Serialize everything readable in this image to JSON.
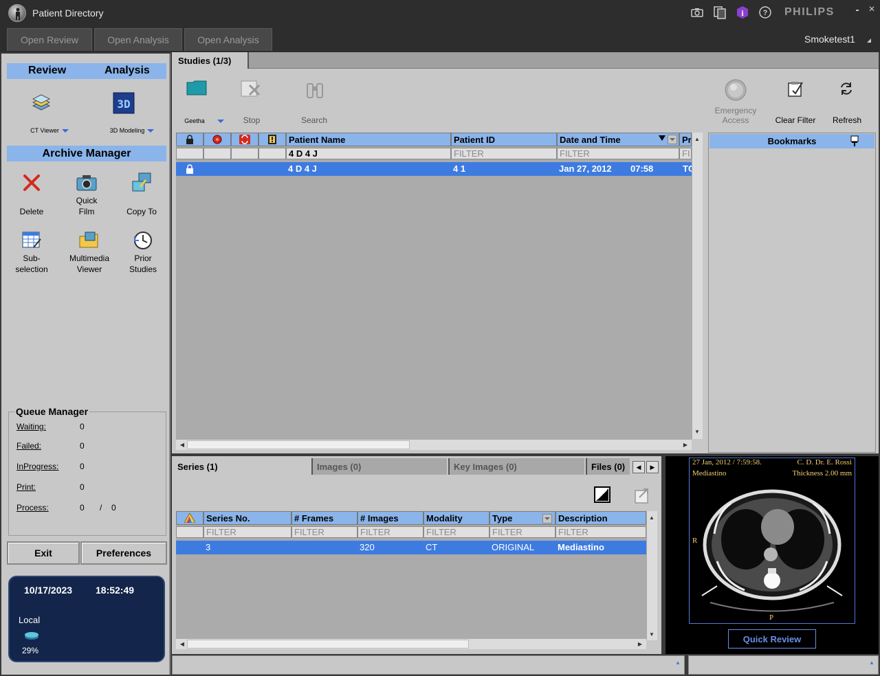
{
  "window": {
    "title": "Patient Directory",
    "brand": "PHILIPS",
    "minimize": "-",
    "close": "×"
  },
  "top_tabs": [
    "Open Review",
    "Open Analysis",
    "Open Analysis"
  ],
  "user": "Smoketest1",
  "left": {
    "review_label": "Review",
    "analysis_label": "Analysis",
    "ct_viewer": "CT Viewer",
    "modeling_3d": "3D Modeling",
    "archive_manager": "Archive Manager",
    "tools": [
      {
        "line1": "",
        "line2": "Delete",
        "icon": "delete-icon"
      },
      {
        "line1": "Quick",
        "line2": "Film",
        "icon": "camera-icon"
      },
      {
        "line1": "",
        "line2": "Copy To",
        "icon": "copy-to-icon"
      },
      {
        "line1": "Sub-",
        "line2": "selection",
        "icon": "subselection-icon"
      },
      {
        "line1": "Multimedia",
        "line2": "Viewer",
        "icon": "folder-icon"
      },
      {
        "line1": "Prior",
        "line2": "Studies",
        "icon": "clock-icon"
      }
    ],
    "queue": {
      "title": "Queue Manager",
      "rows": [
        {
          "label": "Waiting:",
          "value": "0"
        },
        {
          "label": "Failed:",
          "value": "0"
        },
        {
          "label": "InProgress:",
          "value": "0"
        },
        {
          "label": "Print:",
          "value": "0"
        },
        {
          "label": "Process:",
          "value": "0"
        }
      ],
      "process_sep": "/",
      "process_total": "0"
    },
    "exit_label": "Exit",
    "preferences_label": "Preferences",
    "status": {
      "date": "10/17/2023",
      "time": "18:52:49",
      "location": "Local",
      "disk_used": "29%"
    }
  },
  "studies": {
    "tab": "Studies (1/3)",
    "toolbar": {
      "source": "Geetha",
      "stop": "Stop",
      "search": "Search",
      "emergency1": "Emergency",
      "emergency2": "Access",
      "clear_filter": "Clear Filter",
      "refresh": "Refresh"
    },
    "columns": [
      "Patient Name",
      "Patient ID",
      "Date and Time",
      "Pr"
    ],
    "filter_text": "FILTER",
    "filter_name": "4 D 4 J",
    "filter_partial": "FI",
    "row": {
      "name": "4 D 4 J",
      "id": "4 1",
      "date": "Jan  27,  2012",
      "time": "07:58",
      "extra": "TC"
    },
    "bookmarks": "Bookmarks"
  },
  "series": {
    "tabs": [
      "Series (1)",
      "Images (0)",
      "Key Images (0)",
      "Files (0)"
    ],
    "columns": [
      "Series No.",
      "# Frames",
      "# Images",
      "Modality",
      "Type",
      "Description"
    ],
    "filter_text": "FILTER",
    "row": {
      "series_no": "3",
      "frames": "",
      "images": "320",
      "modality": "CT",
      "type": "ORIGINAL",
      "description": "Mediastino"
    }
  },
  "preview": {
    "date": "27 Jan, 2012 / 7:59:58.",
    "doctor": "C. D. Dr. E. Rossi",
    "series": "Mediastino",
    "thickness": "Thickness 2.00 mm",
    "r": "R",
    "p": "P",
    "quick_review": "Quick Review"
  },
  "colors": {
    "header_blue": "#8ab4ea",
    "selection_blue": "#3d7be0",
    "panel_gray": "#c8c8c8",
    "status_navy": "#13254a"
  }
}
